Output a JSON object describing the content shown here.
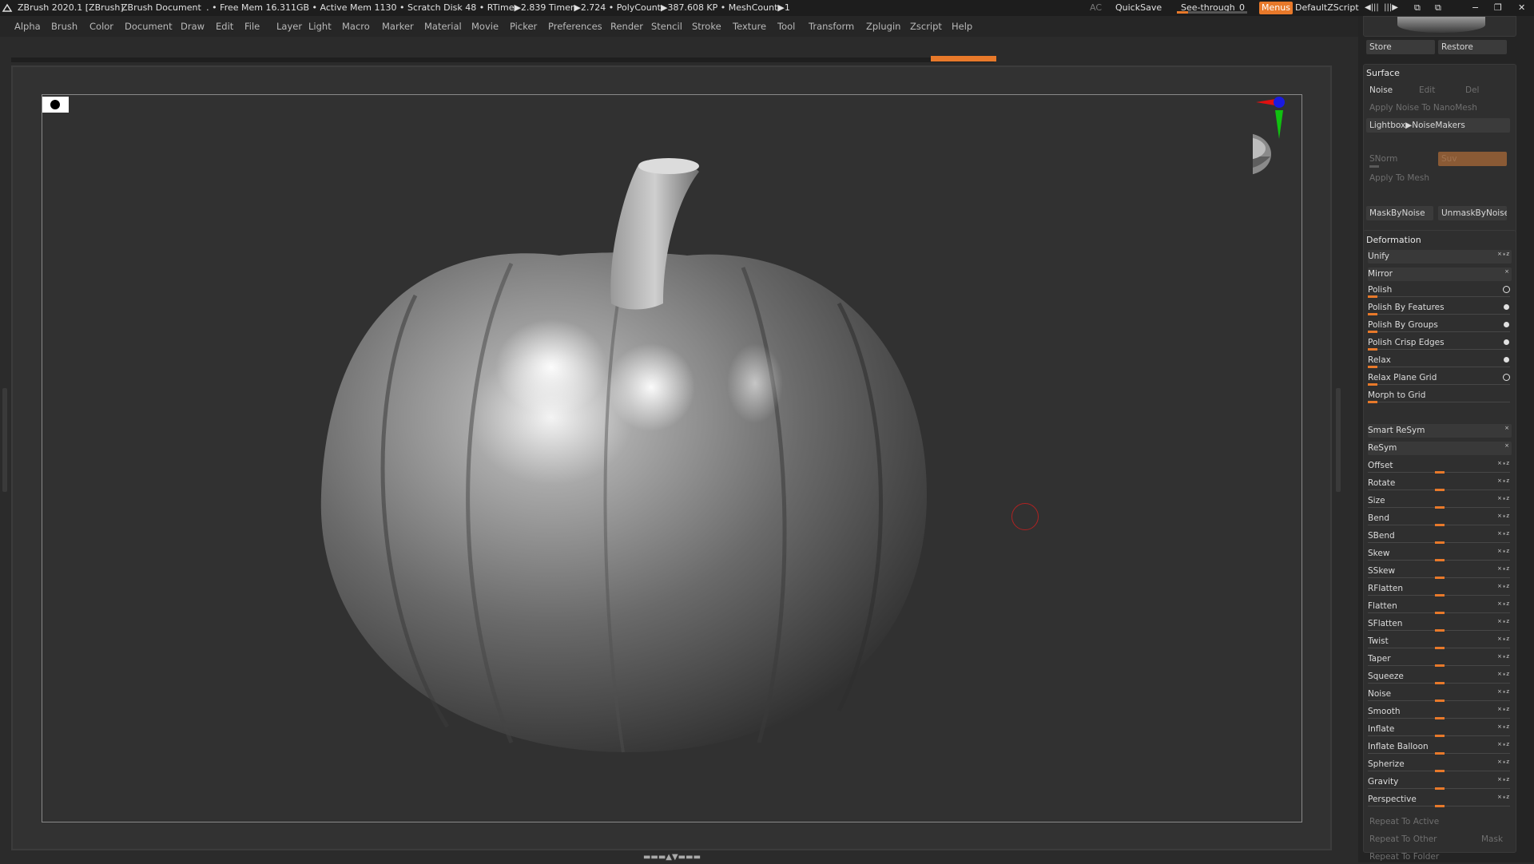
{
  "titlebar": {
    "app_title": "ZBrush 2020.1 [ZBrush]",
    "document": "ZBrush Document",
    "stats": "․ • Free Mem 16.311GB • Active Mem 1130 • Scratch Disk 48 •  RTime▶2.839 Timer▶2.724 • PolyCount▶387.608 KP  • MeshCount▶1",
    "ac": "AC",
    "quicksave": "QuickSave",
    "see_through_label": "See-through",
    "see_through_value": "0",
    "see_through_level": 0.0,
    "menus": "Menus",
    "default_zscript": "DefaultZScript"
  },
  "menubar": [
    "Alpha",
    "Brush",
    "Color",
    "Document",
    "Draw",
    "Edit",
    "File",
    "Layer",
    "Light",
    "Macro",
    "Marker",
    "Material",
    "Movie",
    "Picker",
    "Preferences",
    "Render",
    "Stencil",
    "Stroke",
    "Texture",
    "Tool",
    "Transform",
    "Zplugin",
    "Zscript",
    "Help"
  ],
  "right_panel": {
    "store": "Store",
    "restore": "Restore",
    "surface": {
      "title": "Surface",
      "noise": "Noise",
      "edit": "Edit",
      "del": "Del",
      "apply_noise_nanomesh": "Apply Noise To NanoMesh",
      "lightbox_noisemakers": "Lightbox▶NoiseMakers",
      "snorm": "SNorm",
      "suv": "Suv",
      "apply_to_mesh": "Apply To Mesh",
      "mask_by_noise": "MaskByNoise",
      "unmask_by_noise": "UnmaskByNoise"
    },
    "deformation": {
      "title": "Deformation",
      "unify": "Unify",
      "mirror": "Mirror",
      "polish_items": [
        "Polish",
        "Polish By Features",
        "Polish By Groups",
        "Polish Crisp Edges",
        "Relax",
        "Relax Plane Grid",
        "Morph to Grid"
      ],
      "smart_resym": "Smart ReSym",
      "resym": "ReSym",
      "sliders": [
        "Offset",
        "Rotate",
        "Size",
        "Bend",
        "SBend",
        "Skew",
        "SSkew",
        "RFlatten",
        "Flatten",
        "SFlatten",
        "Twist",
        "Taper",
        "Squeeze",
        "Noise",
        "Smooth",
        "Inflate",
        "Inflate Balloon",
        "Spherize",
        "Gravity",
        "Perspective"
      ],
      "repeat_to_active": "Repeat To Active",
      "repeat_to_other": "Repeat To Other",
      "mask": "Mask",
      "repeat_to_folder": "Repeat To Folder"
    }
  },
  "colors": {
    "accent": "#e8792a",
    "background": "#2b2b2b",
    "gyro_x": "#e01010",
    "gyro_y": "#10c010",
    "gyro_z": "#1a1ae0"
  }
}
